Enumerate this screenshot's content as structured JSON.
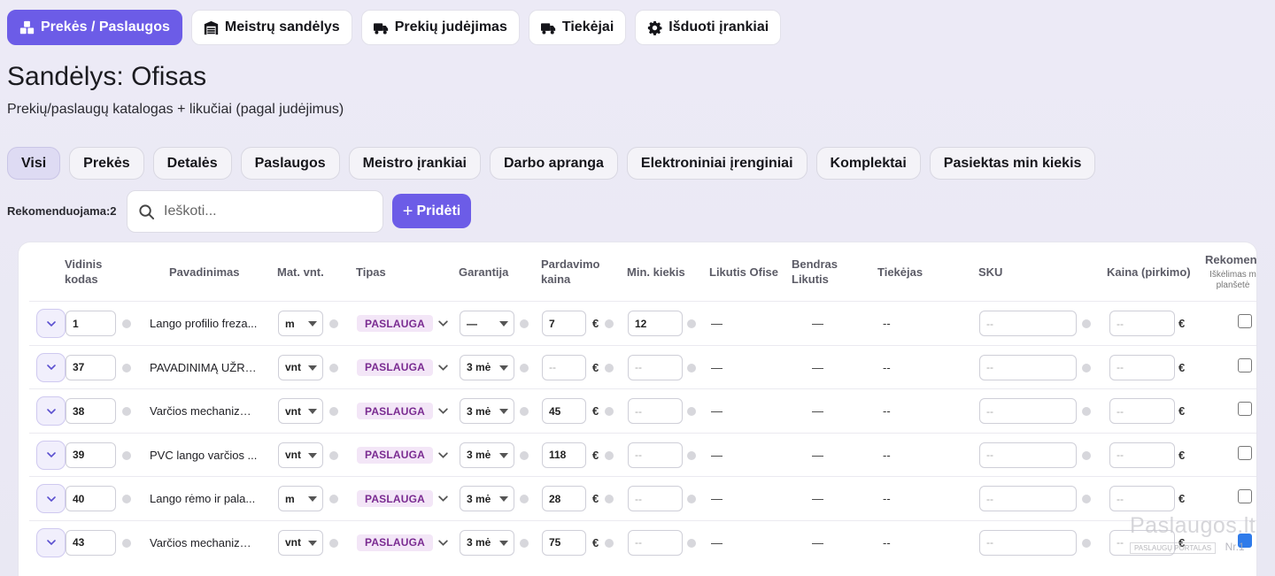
{
  "nav": {
    "items": [
      {
        "label": "Prekės / Paslaugos",
        "icon": "boxes-icon",
        "active": true
      },
      {
        "label": "Meistrų sandėlys",
        "icon": "warehouse-icon",
        "active": false
      },
      {
        "label": "Prekių judėjimas",
        "icon": "truck-icon",
        "active": false
      },
      {
        "label": "Tiekėjai",
        "icon": "truck-icon",
        "active": false
      },
      {
        "label": "Išduoti įrankiai",
        "icon": "gear-icon",
        "active": false
      }
    ]
  },
  "page": {
    "title": "Sandėlys: Ofisas",
    "subtitle": "Prekių/paslaugų katalogas + likučiai (pagal judėjimus)"
  },
  "filters": [
    "Visi",
    "Prekės",
    "Detalės",
    "Paslaugos",
    "Meistro įrankiai",
    "Darbo apranga",
    "Elektroniniai įrenginiai",
    "Komplektai",
    "Pasiektas min kiekis"
  ],
  "toolbar": {
    "recommended_label": "Rekomenduojama:2",
    "search_placeholder": "Ieškoti...",
    "add_label": "Pridėti"
  },
  "table": {
    "headers": {
      "code": "Vidinis kodas",
      "name": "Pavadinimas",
      "unit": "Mat. vnt.",
      "type": "Tipas",
      "warranty": "Garantija",
      "price": "Pardavimo kaina",
      "min_qty": "Min. kiekis",
      "stock_office": "Likutis Ofise",
      "stock_total": "Bendras Likutis",
      "supplier": "Tiekėjas",
      "sku": "SKU",
      "purchase_price": "Kaina (pirkimo)",
      "recommend": "Rekomen",
      "recommend_sub": "Iškėlimas m planšetė"
    },
    "placeholder": "--",
    "dash": "—",
    "euro": "€",
    "rows": [
      {
        "code": "1",
        "name": "Lango profilio freza...",
        "unit": "m",
        "type": "PASLAUGA",
        "warranty": "—",
        "price": "7",
        "min_qty": "12",
        "stock_office": "—",
        "stock_total": "—",
        "supplier": "--",
        "recommended": false
      },
      {
        "code": "37",
        "name": "PAVADINIMĄ UŽRAŠYTI",
        "unit": "vnt",
        "type": "PASLAUGA",
        "warranty": "3 mė",
        "price": "",
        "min_qty": "",
        "stock_office": "—",
        "stock_total": "—",
        "supplier": "--",
        "recommended": false
      },
      {
        "code": "38",
        "name": "Varčios mechanizmo...",
        "unit": "vnt",
        "type": "PASLAUGA",
        "warranty": "3 mė",
        "price": "45",
        "min_qty": "",
        "stock_office": "—",
        "stock_total": "—",
        "supplier": "--",
        "recommended": false
      },
      {
        "code": "39",
        "name": "PVC lango varčios ...",
        "unit": "vnt",
        "type": "PASLAUGA",
        "warranty": "3 mė",
        "price": "118",
        "min_qty": "",
        "stock_office": "—",
        "stock_total": "—",
        "supplier": "--",
        "recommended": false
      },
      {
        "code": "40",
        "name": "Lango rėmo ir pala...",
        "unit": "m",
        "type": "PASLAUGA",
        "warranty": "3 mė",
        "price": "28",
        "min_qty": "",
        "stock_office": "—",
        "stock_total": "—",
        "supplier": "--",
        "recommended": false
      },
      {
        "code": "43",
        "name": "Varčios mechanizmo...",
        "unit": "vnt",
        "type": "PASLAUGA",
        "warranty": "3 mė",
        "price": "75",
        "min_qty": "",
        "stock_office": "—",
        "stock_total": "—",
        "supplier": "--",
        "recommended": true
      }
    ]
  },
  "watermark": {
    "brand": "Paslaugos.lt",
    "tagline": "PASLAUGŲ PORTALAS",
    "rank": "Nr.1"
  },
  "colors": {
    "accent": "#6c5ce7",
    "badge_bg": "#f3e6f7",
    "badge_text": "#7a2b91",
    "check": "#2f7bea"
  }
}
